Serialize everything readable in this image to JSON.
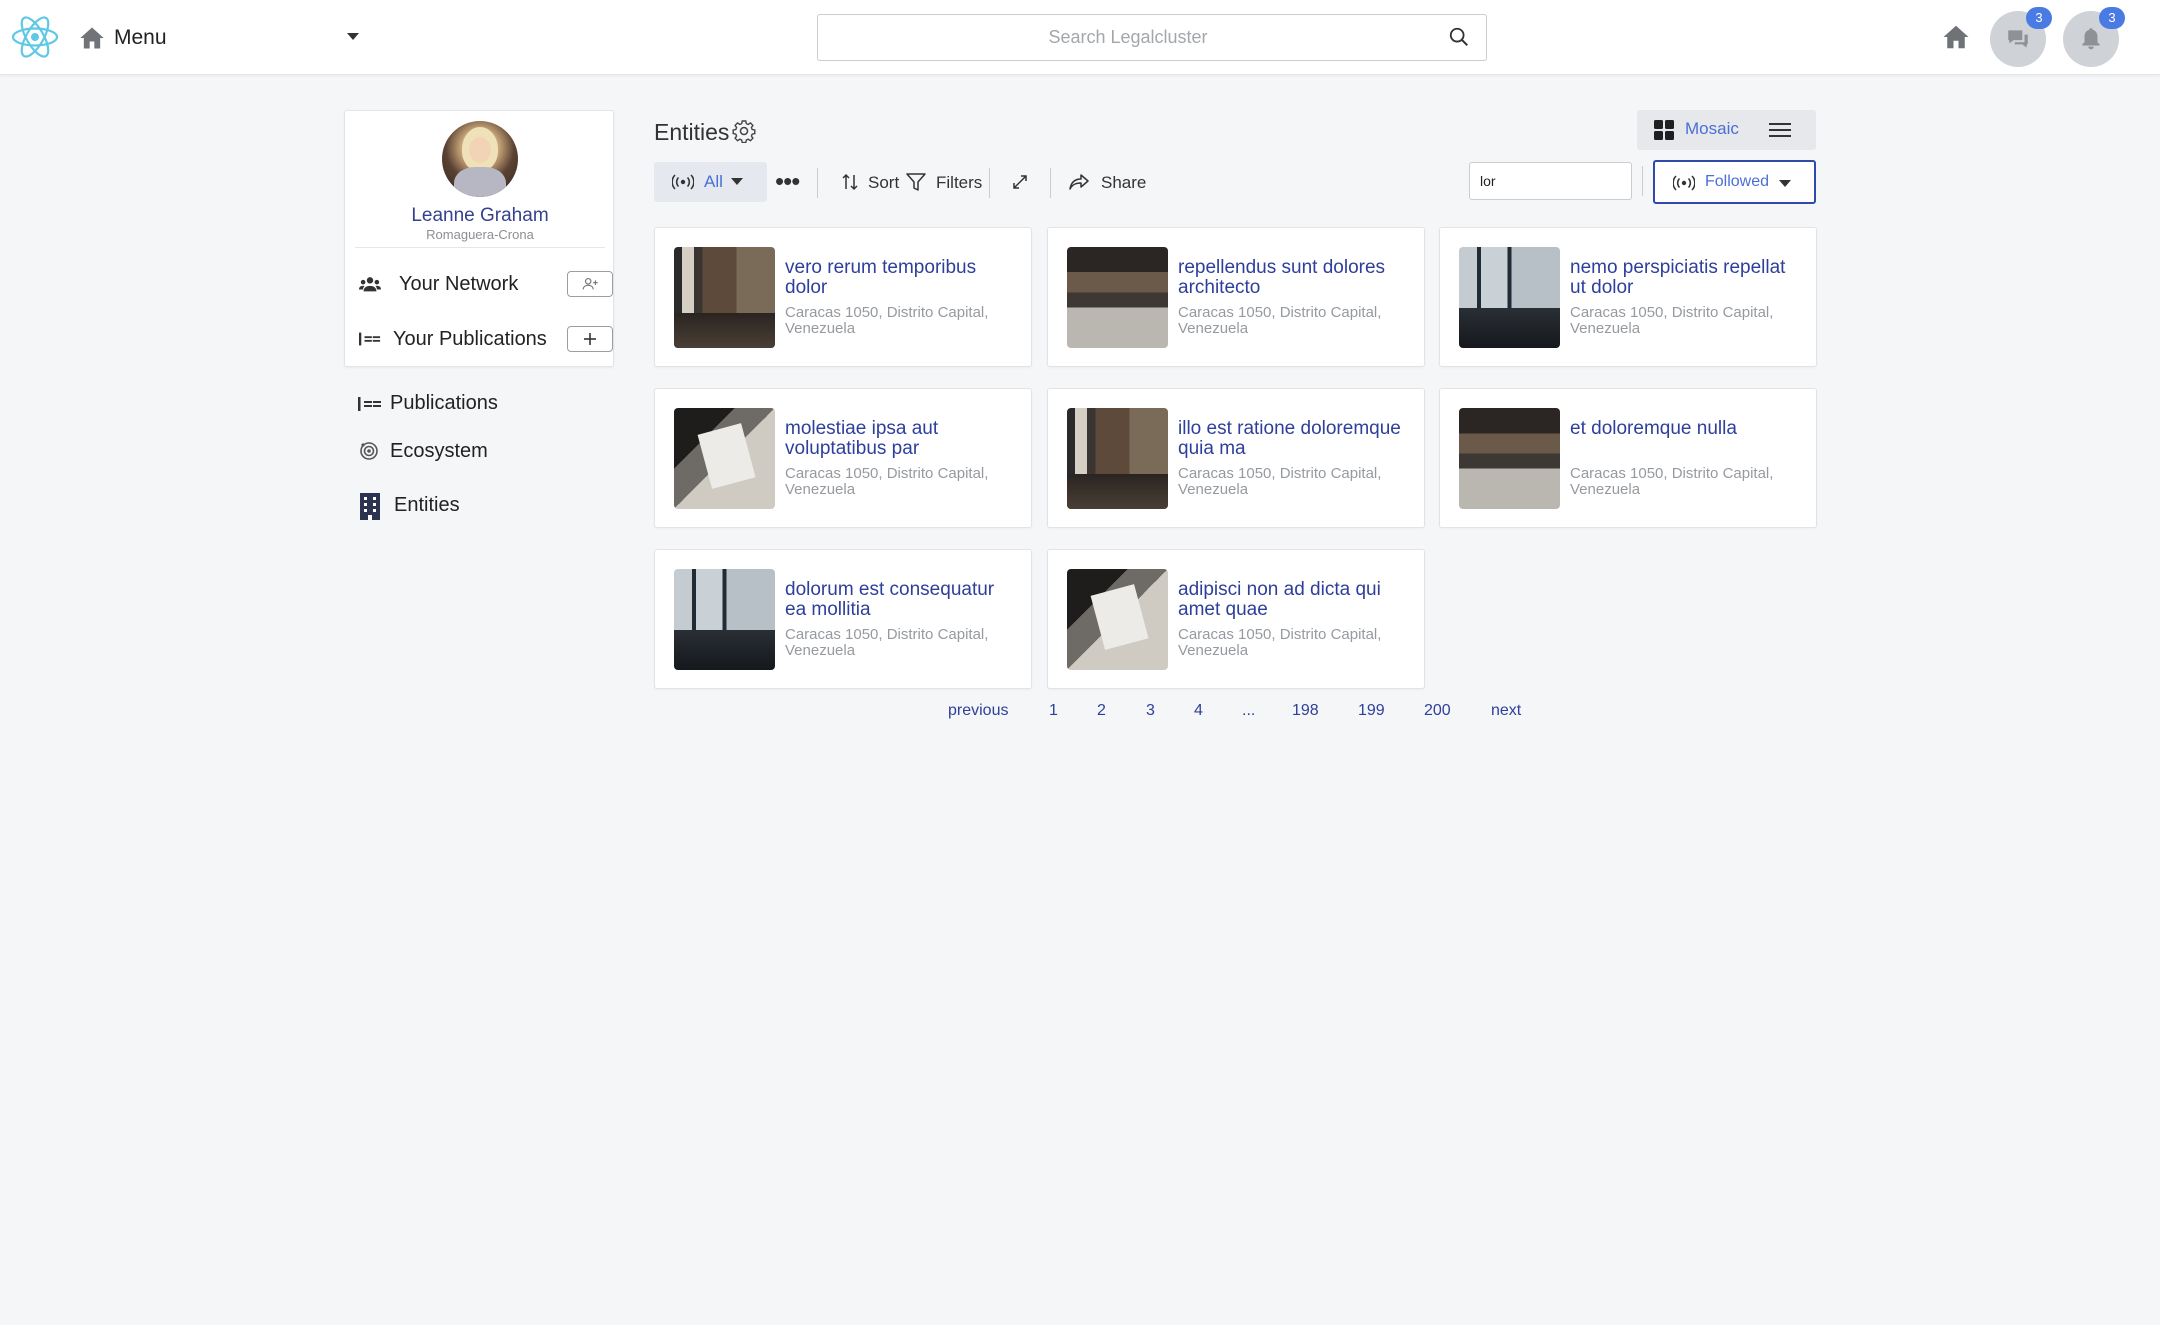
{
  "header": {
    "menu_label": "Menu",
    "search_placeholder": "Search Legalcluster",
    "messages_count": "3",
    "notifications_count": "3"
  },
  "profile": {
    "name": "Leanne Graham",
    "organization": "Romaguera-Crona",
    "network_label": "Your Network",
    "publications_label": "Your Publications"
  },
  "side_nav": {
    "publications": "Publications",
    "ecosystem": "Ecosystem",
    "entities": "Entities"
  },
  "main": {
    "title": "Entities",
    "view_mode": "Mosaic",
    "filter_all": "All",
    "sort_label": "Sort",
    "filters_label": "Filters",
    "share_label": "Share",
    "filter_input_value": "lor",
    "followed_label": "Followed"
  },
  "cards": [
    {
      "title": "vero rerum temporibus dolor",
      "address": "Caracas 1050, Distrito Capital, Venezuela",
      "thumb": "office-shelves"
    },
    {
      "title": "repellendus sunt dolores architecto",
      "address": "Caracas 1050, Distrito Capital, Venezuela",
      "thumb": "open-office"
    },
    {
      "title": "nemo perspiciatis repellat ut dolor",
      "address": "Caracas 1050, Distrito Capital, Venezuela",
      "thumb": "window-desk"
    },
    {
      "title": "molestiae ipsa aut voluptatibus par",
      "address": "Caracas 1050, Distrito Capital, Venezuela",
      "thumb": "notebook-pen"
    },
    {
      "title": "illo est ratione doloremque quia ma",
      "address": "Caracas 1050, Distrito Capital, Venezuela",
      "thumb": "office-shelves"
    },
    {
      "title": "et doloremque nulla",
      "address": "Caracas 1050, Distrito Capital, Venezuela",
      "thumb": "open-office"
    },
    {
      "title": "dolorum est consequatur ea mollitia",
      "address": "Caracas 1050, Distrito Capital, Venezuela",
      "thumb": "window-desk"
    },
    {
      "title": "adipisci non ad dicta qui amet quae",
      "address": "Caracas 1050, Distrito Capital, Venezuela",
      "thumb": "notebook-pen"
    }
  ],
  "pagination": {
    "previous": "previous",
    "pages": [
      "1",
      "2",
      "3",
      "4",
      "...",
      "198",
      "199",
      "200"
    ],
    "next": "next"
  },
  "colors": {
    "accent": "#4a6fd6",
    "link": "#2e3f9b",
    "badge": "#4a7be5",
    "logo": "#5ec8e5"
  }
}
